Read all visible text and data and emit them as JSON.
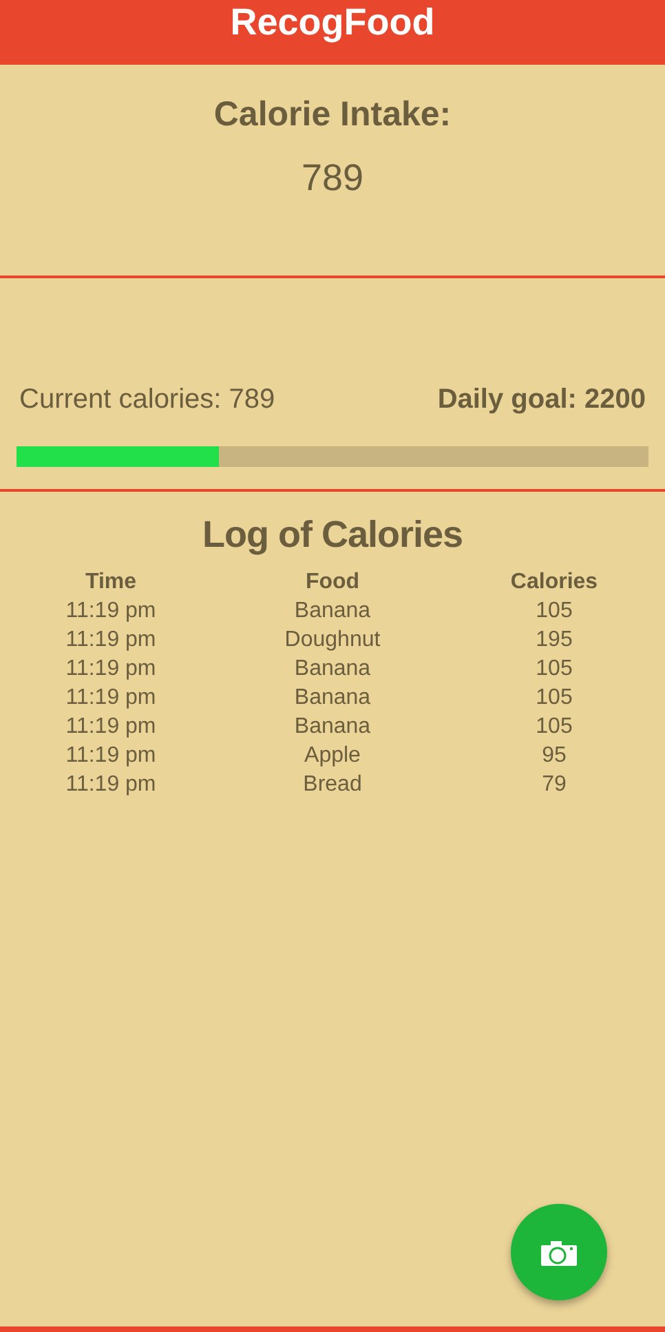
{
  "app_bar": {
    "title": "RecogFood"
  },
  "intake": {
    "label": "Calorie Intake:",
    "value": "789"
  },
  "progress": {
    "current": "Current calories: 789",
    "goal": "Daily goal: 2200",
    "level": 0.32
  },
  "log": {
    "title": "Log of Calories",
    "columns": [
      "Time",
      "Food",
      "Calories"
    ],
    "rows": [
      [
        "11:19 pm",
        "Banana",
        "105"
      ],
      [
        "11:19 pm",
        "Doughnut",
        "195"
      ],
      [
        "11:19 pm",
        "Banana",
        "105"
      ],
      [
        "11:19 pm",
        "Banana",
        "105"
      ],
      [
        "11:19 pm",
        "Banana",
        "105"
      ],
      [
        "11:19 pm",
        "Apple",
        "95"
      ],
      [
        "11:19 pm",
        "Bread",
        "79"
      ]
    ]
  }
}
